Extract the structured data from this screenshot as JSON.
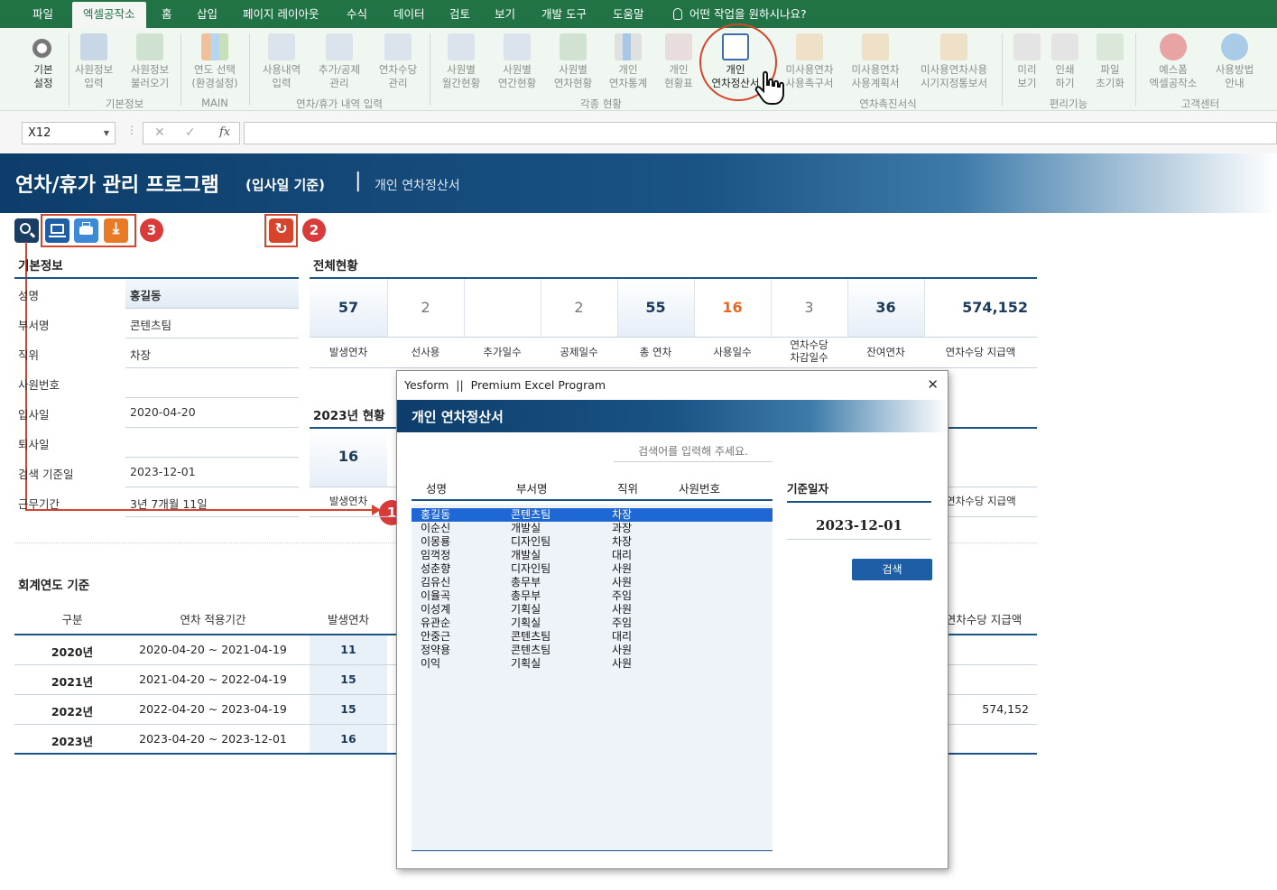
{
  "menu": {
    "tabs": [
      "파일",
      "엑셀공작소",
      "홈",
      "삽입",
      "페이지 레이아웃",
      "수식",
      "데이터",
      "검토",
      "보기",
      "개발 도구",
      "도움말"
    ],
    "active_tab": "엑셀공작소",
    "tell_me": "어떤 작업을 원하시나요?"
  },
  "ribbon": {
    "buttons": [
      {
        "label1": "기본",
        "label2": "설정"
      },
      {
        "label1": "사원정보",
        "label2": "입력"
      },
      {
        "label1": "사원정보",
        "label2": "불러오기"
      },
      {
        "label1": "연도 선택",
        "label2": "(환경설정)"
      },
      {
        "label1": "사용내역",
        "label2": "입력"
      },
      {
        "label1": "추가/공제",
        "label2": "관리"
      },
      {
        "label1": "연차수당",
        "label2": "관리"
      },
      {
        "label1": "사원별",
        "label2": "월간현황"
      },
      {
        "label1": "사원별",
        "label2": "연간현황"
      },
      {
        "label1": "사원별",
        "label2": "연차현황"
      },
      {
        "label1": "개인",
        "label2": "연차통계"
      },
      {
        "label1": "개인",
        "label2": "현황표"
      },
      {
        "label1": "개인",
        "label2": "연차정산서"
      },
      {
        "label1": "미사용연차",
        "label2": "사용촉구서"
      },
      {
        "label1": "미사용연차",
        "label2": "사용계획서"
      },
      {
        "label1": "미사용연차사용",
        "label2": "시기지정통보서"
      },
      {
        "label1": "미리",
        "label2": "보기"
      },
      {
        "label1": "인쇄",
        "label2": "하기"
      },
      {
        "label1": "파일",
        "label2": "초기화"
      },
      {
        "label1": "예스폼",
        "label2": "엑셀공작소"
      },
      {
        "label1": "사용방법",
        "label2": "안내"
      }
    ],
    "groups": [
      "기본정보",
      "MAIN",
      "연차/휴가 내역 입력",
      "각종 현황",
      "연차촉진서식",
      "편리기능",
      "고객센터"
    ]
  },
  "formula_bar": {
    "name_box": "X12",
    "formula": ""
  },
  "banner": {
    "title": "연차/휴가 관리 프로그램",
    "subtitle": "(입사일 기준)",
    "separator": "|",
    "page": "개인 연차정산서"
  },
  "badges": [
    "1",
    "2",
    "3"
  ],
  "basic_info": {
    "title": "기본정보",
    "rows": [
      {
        "label": "성명",
        "value": "홍길동"
      },
      {
        "label": "부서명",
        "value": "콘텐츠팀"
      },
      {
        "label": "직위",
        "value": "차장"
      },
      {
        "label": "사원번호",
        "value": ""
      },
      {
        "label": "입사일",
        "value": "2020-04-20"
      },
      {
        "label": "퇴사일",
        "value": ""
      },
      {
        "label": "검색 기준일",
        "value": "2023-12-01"
      },
      {
        "label": "근무기간",
        "value": "3년 7개월 11일"
      }
    ]
  },
  "overall": {
    "title": "전체현황",
    "stats": [
      {
        "value": "57",
        "label1": "발생연차",
        "label2": ""
      },
      {
        "value": "2",
        "label1": "선사용",
        "label2": ""
      },
      {
        "value": "",
        "label1": "추가일수",
        "label2": ""
      },
      {
        "value": "2",
        "label1": "공제일수",
        "label2": ""
      },
      {
        "value": "55",
        "label1": "총 연차",
        "label2": ""
      },
      {
        "value": "16",
        "label1": "사용일수",
        "label2": ""
      },
      {
        "value": "3",
        "label1": "연차수당",
        "label2": "차감일수"
      },
      {
        "value": "36",
        "label1": "잔여연차",
        "label2": ""
      },
      {
        "value": "574,152",
        "label1": "연차수당 지급액",
        "label2": ""
      }
    ],
    "colors": {
      "accent": "#e86a1e",
      "dark": "#1e3a5c",
      "light": "#777777"
    }
  },
  "year_status": {
    "title": "2023년 현황",
    "value": "16",
    "label": "발생연차",
    "right_label": "연차수당 지급액"
  },
  "fiscal": {
    "title": "회계연도 기준",
    "headers": [
      "구분",
      "연차 적용기간",
      "발생연차",
      "연차수당 지급액"
    ],
    "rows": [
      {
        "year": "2020년",
        "period": "2020-04-20 ~ 2021-04-19",
        "days": "11",
        "pay": ""
      },
      {
        "year": "2021년",
        "period": "2021-04-20 ~ 2022-04-19",
        "days": "15",
        "pay": ""
      },
      {
        "year": "2022년",
        "period": "2022-04-20 ~ 2023-04-19",
        "days": "15",
        "pay": "574,152"
      },
      {
        "year": "2023년",
        "period": "2023-04-20 ~ 2023-12-01",
        "days": "16",
        "pay": ""
      }
    ]
  },
  "dialog": {
    "window_title": "Yesform  ||  Premium Excel Program",
    "header": "개인 연차정산서",
    "search_placeholder": "검색어를 입력해 주세요.",
    "columns": [
      "성명",
      "부서명",
      "직위",
      "사원번호"
    ],
    "employees": [
      {
        "name": "홍길동",
        "dept": "콘텐츠팀",
        "pos": "차장",
        "id": ""
      },
      {
        "name": "이순신",
        "dept": "개발실",
        "pos": "과장",
        "id": ""
      },
      {
        "name": "이몽룡",
        "dept": "디자인팀",
        "pos": "차장",
        "id": ""
      },
      {
        "name": "임꺽정",
        "dept": "개발실",
        "pos": "대리",
        "id": ""
      },
      {
        "name": "성춘향",
        "dept": "디자인팀",
        "pos": "사원",
        "id": ""
      },
      {
        "name": "김유신",
        "dept": "총무부",
        "pos": "사원",
        "id": ""
      },
      {
        "name": "이율곡",
        "dept": "총무부",
        "pos": "주임",
        "id": ""
      },
      {
        "name": "이성계",
        "dept": "기획실",
        "pos": "사원",
        "id": ""
      },
      {
        "name": "유관순",
        "dept": "기획실",
        "pos": "주임",
        "id": ""
      },
      {
        "name": "안중근",
        "dept": "콘텐츠팀",
        "pos": "대리",
        "id": ""
      },
      {
        "name": "정약용",
        "dept": "콘텐츠팀",
        "pos": "사원",
        "id": ""
      },
      {
        "name": "이익",
        "dept": "기획실",
        "pos": "사원",
        "id": ""
      }
    ],
    "selected_index": 0,
    "date_label": "기준일자",
    "date_value": "2023-12-01",
    "search_button": "검색",
    "close": "✕"
  }
}
